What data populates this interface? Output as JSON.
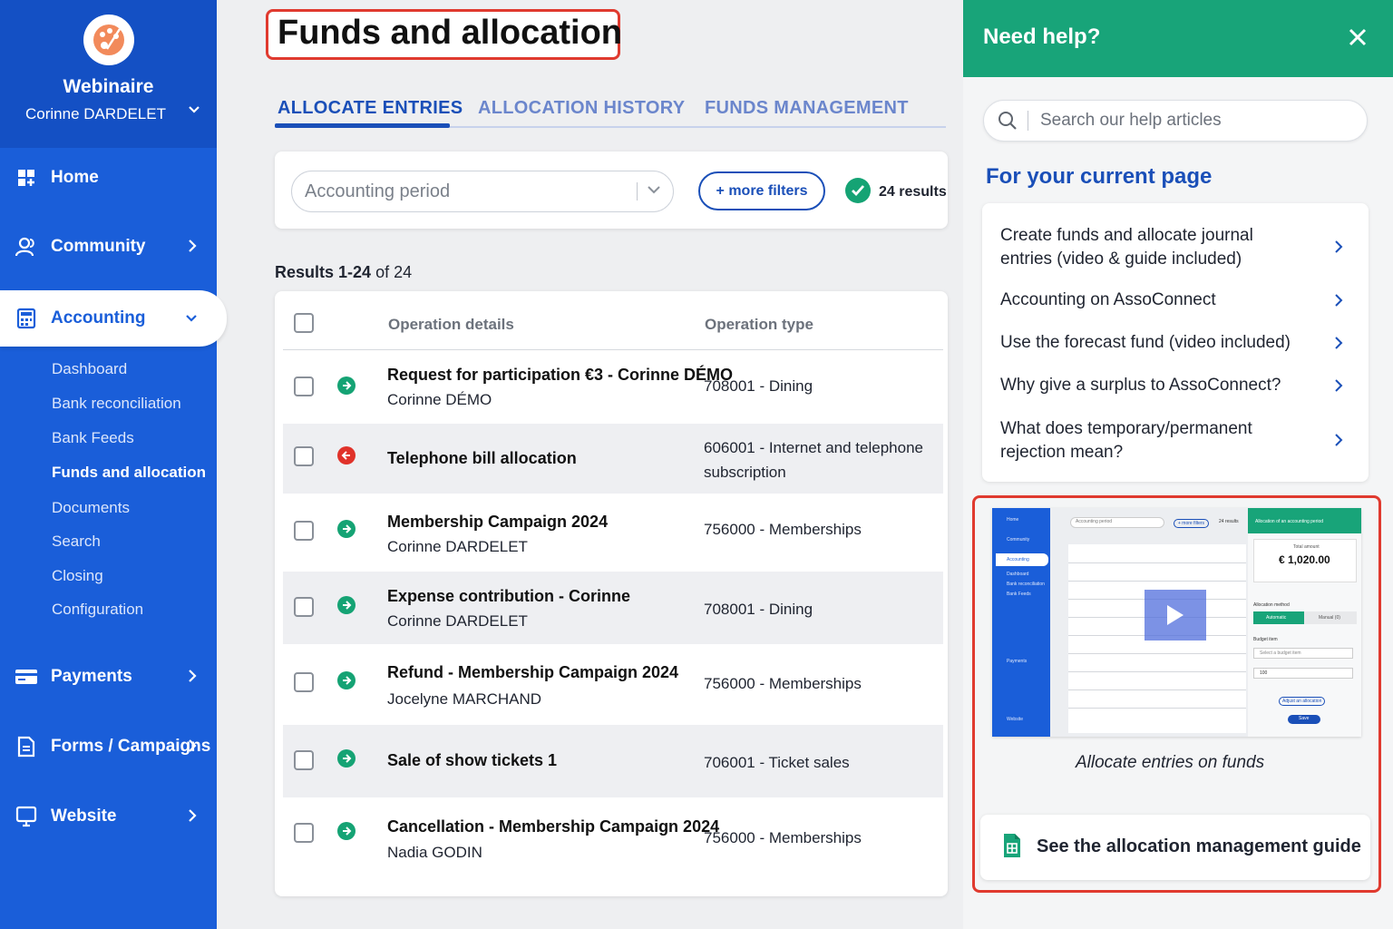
{
  "sidebar": {
    "org_name": "Webinaire",
    "user_name": "Corinne DARDELET",
    "nav": {
      "home": "Home",
      "community": "Community",
      "accounting": "Accounting",
      "payments": "Payments",
      "forms": "Forms / Campaigns",
      "website": "Website"
    },
    "accounting_sub": [
      "Dashboard",
      "Bank reconciliation",
      "Bank Feeds",
      "Funds and allocation",
      "Documents",
      "Search",
      "Closing",
      "Configuration"
    ]
  },
  "main": {
    "title": "Funds and allocation",
    "tabs": [
      "ALLOCATE ENTRIES",
      "ALLOCATION HISTORY",
      "FUNDS MANAGEMENT"
    ],
    "filters": {
      "period_placeholder": "Accounting period",
      "more_filters": "+ more filters",
      "results": "24 results"
    },
    "results_prefix": "Results 1-24",
    "results_suffix": " of 24",
    "table": {
      "columns": [
        "Operation details",
        "Operation type"
      ],
      "rows": [
        {
          "title": "Request for participation €3 - Corinne DÉMO",
          "subtitle": "Corinne DÉMO",
          "type": "708001 - Dining",
          "direction": "in"
        },
        {
          "title": "Telephone bill allocation",
          "subtitle": "",
          "type": "606001 - Internet and telephone subscription",
          "direction": "out"
        },
        {
          "title": "Membership Campaign 2024",
          "subtitle": "Corinne DARDELET",
          "type": "756000 - Memberships",
          "direction": "in"
        },
        {
          "title": "Expense contribution - Corinne",
          "subtitle": "Corinne DARDELET",
          "type": "708001 - Dining",
          "direction": "in"
        },
        {
          "title": "Refund - Membership Campaign 2024",
          "subtitle": "Jocelyne MARCHAND",
          "type": "756000 - Memberships",
          "direction": "in"
        },
        {
          "title": "Sale of show tickets 1",
          "subtitle": "",
          "type": "706001 - Ticket sales",
          "direction": "in"
        },
        {
          "title": "Cancellation - Membership Campaign 2024",
          "subtitle": "Nadia GODIN",
          "type": "756000 - Memberships",
          "direction": "in"
        }
      ]
    }
  },
  "help": {
    "title": "Need help?",
    "search_placeholder": "Search our help articles",
    "section_title": "For your current page",
    "articles": [
      "Create funds and allocate journal entries (video & guide included)",
      "Accounting on AssoConnect",
      "Use the forecast fund (video included)",
      "Why give a surplus to AssoConnect?",
      "What does temporary/permanent rejection mean?"
    ],
    "video_caption": "Allocate entries on funds",
    "video_preview": {
      "side": [
        "Home",
        "Community",
        "Accounting",
        "Dashboard",
        "Bank reconciliation",
        "Bank Feeds",
        "Payments",
        "Website"
      ],
      "filter": "Accounting period",
      "more": "+ more filters",
      "results": "24 results",
      "panel_title": "Allocation of an accounting period",
      "total_label": "Total amount",
      "total_value": "€ 1,020.00",
      "method_label": "Allocation method",
      "auto": "Automatic",
      "manual": "Manual (0)",
      "budget_label": "Budget item",
      "budget_placeholder": "Select a budget item",
      "amount": "100",
      "adjust": "Adjust an allocation",
      "save": "Save"
    },
    "guide_label": "See the allocation management guide"
  },
  "colors": {
    "sidebar": "#1a5ed9",
    "accent": "#1a4fb8",
    "help_header": "#18a479",
    "highlight": "#e03a2f",
    "incoming": "#15a374",
    "outgoing": "#e0322a"
  }
}
